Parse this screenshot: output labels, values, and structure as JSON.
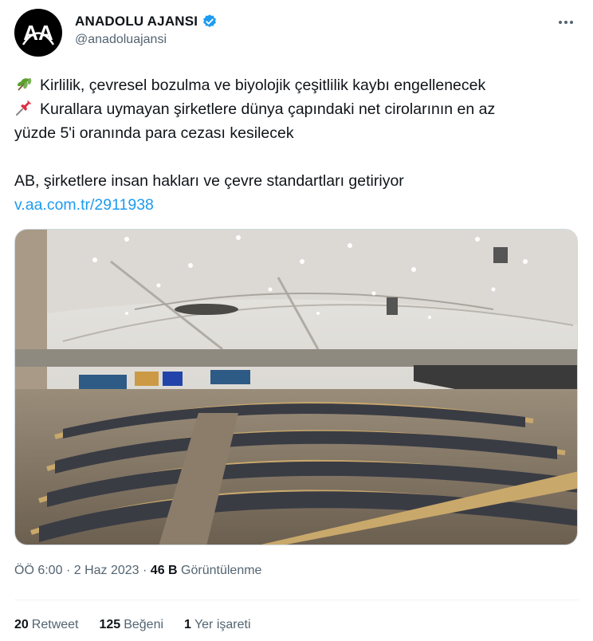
{
  "account": {
    "name": "ANADOLU AJANSI",
    "handle": "@anadoluajansi",
    "verified": true,
    "avatar_text": "AA",
    "avatar_bg": "#000000"
  },
  "tweet": {
    "line1": "Kirlilik, çevresel bozulma ve biyolojik çeşitlilik kaybı engellenecek",
    "line2": "Kurallara uymayan şirketlere dünya çapındaki net cirolarının en az",
    "line3": "yüzde 5'i oranında para cezası kesilecek",
    "line4": "AB, şirketlere insan hakları ve çevre standartları getiriyor",
    "link": "v.aa.com.tr/2911938",
    "emoji1": "sprout-icon",
    "emoji2": "pushpin-icon"
  },
  "media": {
    "subject": "european-parliament-plenary-photo"
  },
  "meta": {
    "time": "ÖÖ 6:00",
    "sep": "·",
    "date": "2 Haz 2023",
    "views_count": "46 B",
    "views_label": "Görüntülenme"
  },
  "stats": {
    "retweets_count": "20",
    "retweets_label": "Retweet",
    "likes_count": "125",
    "likes_label": "Beğeni",
    "bookmarks_count": "1",
    "bookmarks_label": "Yer işareti"
  },
  "colors": {
    "link": "#1d9bf0",
    "verified": "#1d9bf0",
    "secondary_text": "#536471"
  }
}
